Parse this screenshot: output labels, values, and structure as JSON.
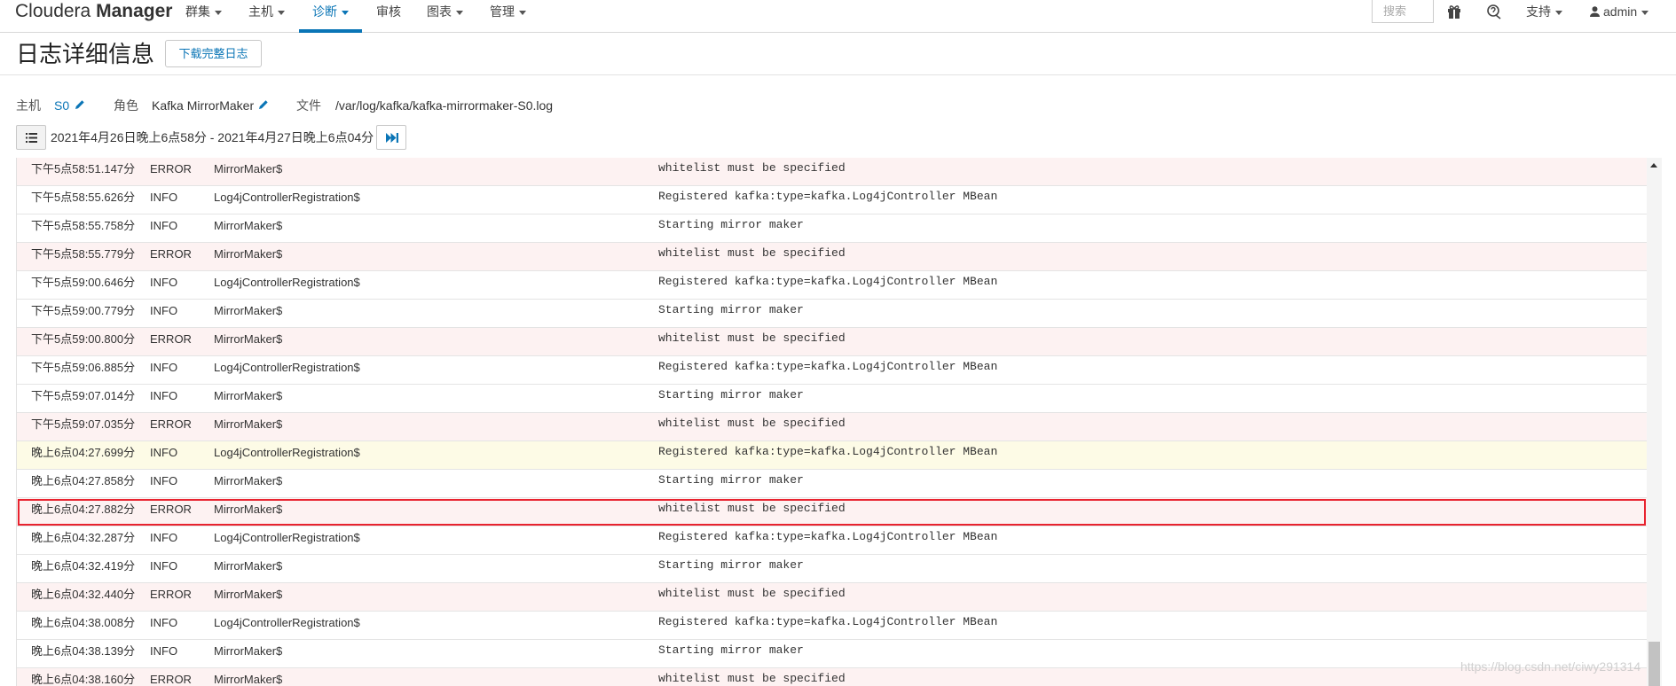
{
  "navbar": {
    "brand_light": "Cloudera",
    "brand_bold": "Manager",
    "items": [
      {
        "label": "群集",
        "dropdown": true
      },
      {
        "label": "主机",
        "dropdown": true
      },
      {
        "label": "诊断",
        "dropdown": true,
        "active": true
      },
      {
        "label": "审核",
        "dropdown": false
      },
      {
        "label": "图表",
        "dropdown": true
      },
      {
        "label": "管理",
        "dropdown": true
      }
    ],
    "search_placeholder": "搜索",
    "icons": [
      "gift-icon",
      "help-icon"
    ],
    "support_label": "支持",
    "user_label": "admin",
    "accent_color": "#0a75b6"
  },
  "header": {
    "title": "日志详细信息",
    "download_label": "下载完整日志"
  },
  "meta": {
    "host_label": "主机",
    "host_value": "S0",
    "role_label": "角色",
    "role_value": "Kafka MirrorMaker",
    "file_label": "文件",
    "file_value": "/var/log/kafka/kafka-mirrormaker-S0.log"
  },
  "time_range": {
    "text": "2021年4月26日晚上6点58分 - 2021年4月27日晚上6点04分"
  },
  "log_rows": [
    {
      "time": "下午5点58:51.147分",
      "level": "ERROR",
      "source": "MirrorMaker$",
      "message": "whitelist must be specified"
    },
    {
      "time": "下午5点58:55.626分",
      "level": "INFO",
      "source": "Log4jControllerRegistration$",
      "message": "Registered kafka:type=kafka.Log4jController MBean"
    },
    {
      "time": "下午5点58:55.758分",
      "level": "INFO",
      "source": "MirrorMaker$",
      "message": "Starting mirror maker"
    },
    {
      "time": "下午5点58:55.779分",
      "level": "ERROR",
      "source": "MirrorMaker$",
      "message": "whitelist must be specified"
    },
    {
      "time": "下午5点59:00.646分",
      "level": "INFO",
      "source": "Log4jControllerRegistration$",
      "message": "Registered kafka:type=kafka.Log4jController MBean"
    },
    {
      "time": "下午5点59:00.779分",
      "level": "INFO",
      "source": "MirrorMaker$",
      "message": "Starting mirror maker"
    },
    {
      "time": "下午5点59:00.800分",
      "level": "ERROR",
      "source": "MirrorMaker$",
      "message": "whitelist must be specified"
    },
    {
      "time": "下午5点59:06.885分",
      "level": "INFO",
      "source": "Log4jControllerRegistration$",
      "message": "Registered kafka:type=kafka.Log4jController MBean"
    },
    {
      "time": "下午5点59:07.014分",
      "level": "INFO",
      "source": "MirrorMaker$",
      "message": "Starting mirror maker"
    },
    {
      "time": "下午5点59:07.035分",
      "level": "ERROR",
      "source": "MirrorMaker$",
      "message": "whitelist must be specified"
    },
    {
      "time": "晚上6点04:27.699分",
      "level": "INFO",
      "source": "Log4jControllerRegistration$",
      "message": "Registered kafka:type=kafka.Log4jController MBean",
      "highlight": true
    },
    {
      "time": "晚上6点04:27.858分",
      "level": "INFO",
      "source": "MirrorMaker$",
      "message": "Starting mirror maker"
    },
    {
      "time": "晚上6点04:27.882分",
      "level": "ERROR",
      "source": "MirrorMaker$",
      "message": "whitelist must be specified",
      "selected": true
    },
    {
      "time": "晚上6点04:32.287分",
      "level": "INFO",
      "source": "Log4jControllerRegistration$",
      "message": "Registered kafka:type=kafka.Log4jController MBean"
    },
    {
      "time": "晚上6点04:32.419分",
      "level": "INFO",
      "source": "MirrorMaker$",
      "message": "Starting mirror maker"
    },
    {
      "time": "晚上6点04:32.440分",
      "level": "ERROR",
      "source": "MirrorMaker$",
      "message": "whitelist must be specified"
    },
    {
      "time": "晚上6点04:38.008分",
      "level": "INFO",
      "source": "Log4jControllerRegistration$",
      "message": "Registered kafka:type=kafka.Log4jController MBean"
    },
    {
      "time": "晚上6点04:38.139分",
      "level": "INFO",
      "source": "MirrorMaker$",
      "message": "Starting mirror maker"
    },
    {
      "time": "晚上6点04:38.160分",
      "level": "ERROR",
      "source": "MirrorMaker$",
      "message": "whitelist must be specified"
    }
  ],
  "colors": {
    "error_row": "#fdf2f2",
    "highlight_row": "#fdfbe6",
    "selected_outline": "#e8232f"
  },
  "watermark": "https://blog.csdn.net/ciwy291314"
}
